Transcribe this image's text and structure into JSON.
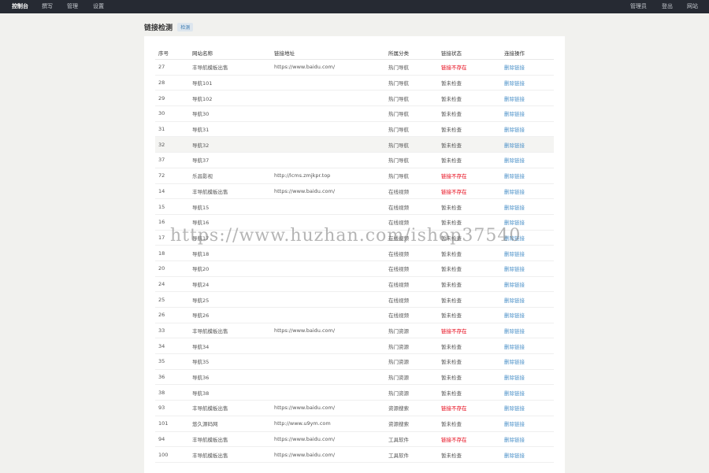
{
  "nav": {
    "left": [
      "控制台",
      "撰写",
      "管理",
      "设置"
    ],
    "right": [
      "管理员",
      "登出",
      "网站"
    ]
  },
  "header": {
    "title": "链接检测",
    "check_button": "检测"
  },
  "table": {
    "columns": [
      "序号",
      "网站名称",
      "链接地址",
      "所属分类",
      "链接状态",
      "连接操作"
    ],
    "rows": [
      {
        "id": "27",
        "name": "丰导航模板出售",
        "url": "https://www.baidu.com/",
        "category": "热门导航",
        "status": "链接不存在",
        "bad": true,
        "op": "删除链接"
      },
      {
        "id": "28",
        "name": "导航101",
        "url": "",
        "category": "热门导航",
        "status": "暂未检查",
        "bad": false,
        "op": "删除链接"
      },
      {
        "id": "29",
        "name": "导航102",
        "url": "",
        "category": "热门导航",
        "status": "暂未检查",
        "bad": false,
        "op": "删除链接"
      },
      {
        "id": "30",
        "name": "导航30",
        "url": "",
        "category": "热门导航",
        "status": "暂未检查",
        "bad": false,
        "op": "删除链接"
      },
      {
        "id": "31",
        "name": "导航31",
        "url": "",
        "category": "热门导航",
        "status": "暂未检查",
        "bad": false,
        "op": "删除链接"
      },
      {
        "id": "32",
        "name": "导航32",
        "url": "",
        "category": "热门导航",
        "status": "暂未检查",
        "bad": false,
        "op": "删除链接",
        "highlight": true
      },
      {
        "id": "37",
        "name": "导航37",
        "url": "",
        "category": "热门导航",
        "status": "暂未检查",
        "bad": false,
        "op": "删除链接"
      },
      {
        "id": "72",
        "name": "乐昌影视",
        "url": "http://lcms.zmjkpr.top",
        "category": "热门导航",
        "status": "链接不存在",
        "bad": true,
        "op": "删除链接"
      },
      {
        "id": "14",
        "name": "丰导航模板出售",
        "url": "https://www.baidu.com/",
        "category": "在线视频",
        "status": "链接不存在",
        "bad": true,
        "op": "删除链接"
      },
      {
        "id": "15",
        "name": "导航15",
        "url": "",
        "category": "在线视频",
        "status": "暂未检查",
        "bad": false,
        "op": "删除链接"
      },
      {
        "id": "16",
        "name": "导航16",
        "url": "",
        "category": "在线视频",
        "status": "暂未检查",
        "bad": false,
        "op": "删除链接"
      },
      {
        "id": "17",
        "name": "导航17",
        "url": "",
        "category": "在线视频",
        "status": "暂未检查",
        "bad": false,
        "op": "删除链接"
      },
      {
        "id": "18",
        "name": "导航18",
        "url": "",
        "category": "在线视频",
        "status": "暂未检查",
        "bad": false,
        "op": "删除链接"
      },
      {
        "id": "20",
        "name": "导航20",
        "url": "",
        "category": "在线视频",
        "status": "暂未检查",
        "bad": false,
        "op": "删除链接"
      },
      {
        "id": "24",
        "name": "导航24",
        "url": "",
        "category": "在线视频",
        "status": "暂未检查",
        "bad": false,
        "op": "删除链接"
      },
      {
        "id": "25",
        "name": "导航25",
        "url": "",
        "category": "在线视频",
        "status": "暂未检查",
        "bad": false,
        "op": "删除链接"
      },
      {
        "id": "26",
        "name": "导航26",
        "url": "",
        "category": "在线视频",
        "status": "暂未检查",
        "bad": false,
        "op": "删除链接"
      },
      {
        "id": "33",
        "name": "丰导航模板出售",
        "url": "https://www.baidu.com/",
        "category": "热门资源",
        "status": "链接不存在",
        "bad": true,
        "op": "删除链接"
      },
      {
        "id": "34",
        "name": "导航34",
        "url": "",
        "category": "热门资源",
        "status": "暂未检查",
        "bad": false,
        "op": "删除链接"
      },
      {
        "id": "35",
        "name": "导航35",
        "url": "",
        "category": "热门资源",
        "status": "暂未检查",
        "bad": false,
        "op": "删除链接"
      },
      {
        "id": "36",
        "name": "导航36",
        "url": "",
        "category": "热门资源",
        "status": "暂未检查",
        "bad": false,
        "op": "删除链接"
      },
      {
        "id": "38",
        "name": "导航38",
        "url": "",
        "category": "热门资源",
        "status": "暂未检查",
        "bad": false,
        "op": "删除链接"
      },
      {
        "id": "93",
        "name": "丰导航模板出售",
        "url": "https://www.baidu.com/",
        "category": "资源搜索",
        "status": "链接不存在",
        "bad": true,
        "op": "删除链接"
      },
      {
        "id": "101",
        "name": "悠久源码网",
        "url": "http://www.u9ym.com",
        "category": "资源搜索",
        "status": "暂未检查",
        "bad": false,
        "op": "删除链接"
      },
      {
        "id": "94",
        "name": "丰导航模板出售",
        "url": "https://www.baidu.com/",
        "category": "工具软件",
        "status": "链接不存在",
        "bad": true,
        "op": "删除链接"
      },
      {
        "id": "100",
        "name": "丰导航模板出售",
        "url": "https://www.baidu.com/",
        "category": "工具软件",
        "status": "暂未检查",
        "bad": false,
        "op": "删除链接"
      }
    ]
  },
  "watermark": "https://www.huzhan.com/ishop37540",
  "colors": {
    "topbar": "#262a33",
    "link": "#4a90c8",
    "error": "#e60012",
    "page_bg": "#f1f1ee"
  }
}
